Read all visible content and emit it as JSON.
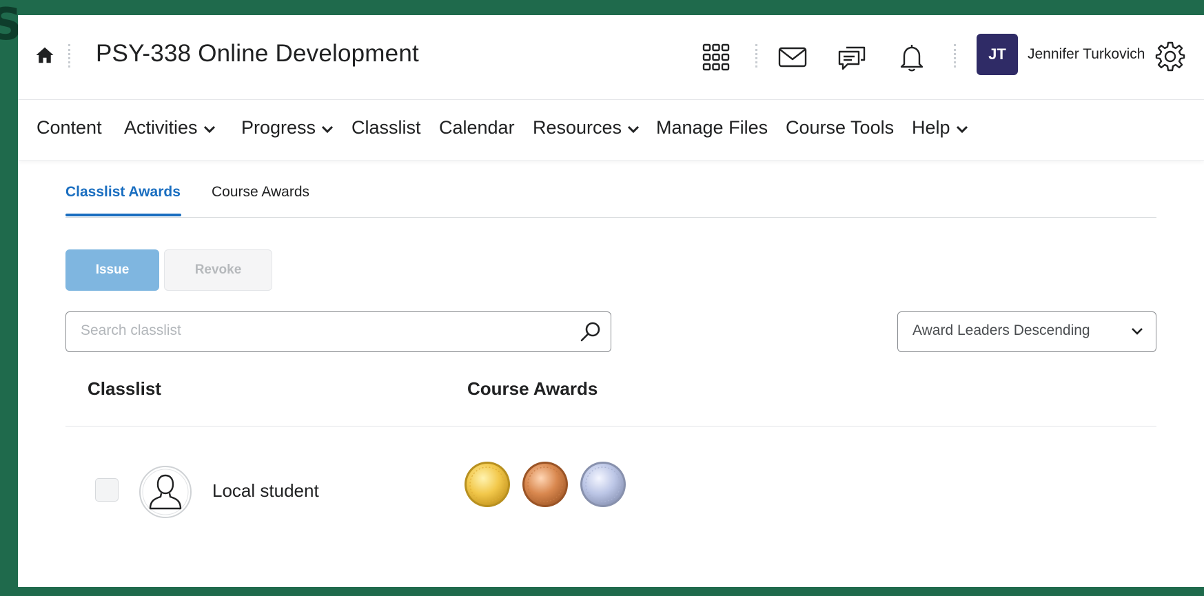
{
  "header": {
    "course_title": "PSY-338 Online Development",
    "user_initials": "JT",
    "user_name": "Jennifer Turkovich",
    "avatar_color": "#2f2b66",
    "icons": [
      "home-icon",
      "apps-grid-icon",
      "mail-icon",
      "chat-icon",
      "bell-icon",
      "gear-icon"
    ]
  },
  "nav": {
    "items": [
      {
        "label": "Content",
        "dropdown": false
      },
      {
        "label": "Activities",
        "dropdown": true
      },
      {
        "label": "Progress",
        "dropdown": true
      },
      {
        "label": "Classlist",
        "dropdown": false
      },
      {
        "label": "Calendar",
        "dropdown": false
      },
      {
        "label": "Resources",
        "dropdown": true
      },
      {
        "label": "Manage Files",
        "dropdown": false
      },
      {
        "label": "Course Tools",
        "dropdown": false
      },
      {
        "label": "Help",
        "dropdown": true
      }
    ]
  },
  "tabs": {
    "active": "Classlist Awards",
    "items": [
      "Classlist Awards",
      "Course Awards"
    ]
  },
  "actions": {
    "issue_label": "Issue",
    "revoke_label": "Revoke"
  },
  "search": {
    "placeholder": "Search classlist"
  },
  "sort": {
    "selected": "Award Leaders Descending"
  },
  "table": {
    "headers": [
      "Classlist",
      "Course Awards"
    ],
    "rows": [
      {
        "name": "Local student",
        "awards": [
          "gold",
          "bronze",
          "silver"
        ]
      }
    ]
  },
  "colors": {
    "frame": "#1f6a4c",
    "accent": "#1a6ec0",
    "issue_button": "#7fb6e0"
  }
}
